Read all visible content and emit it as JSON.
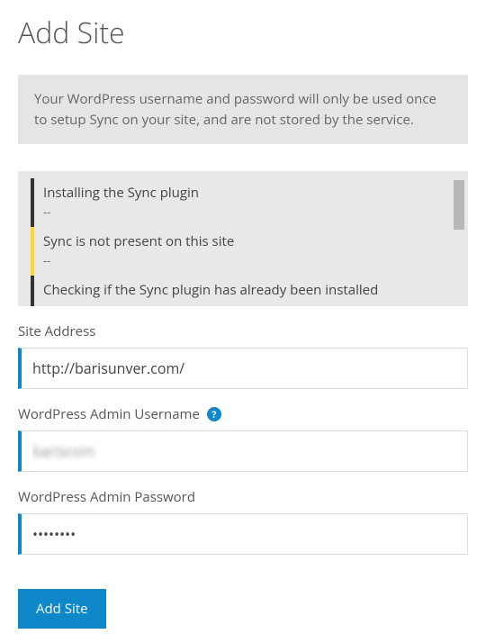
{
  "page": {
    "title": "Add Site"
  },
  "info": {
    "text": "Your WordPress username and password will only be used once to setup Sync on your site, and are not stored by the service."
  },
  "log": {
    "entries": [
      {
        "text": "Installing the Sync plugin",
        "status": "normal"
      },
      {
        "text": "Sync is not present on this site",
        "status": "warning"
      },
      {
        "text": "Checking if the Sync plugin has already been installed",
        "status": "normal"
      }
    ],
    "separator": "--"
  },
  "form": {
    "site_address": {
      "label": "Site Address",
      "value": "http://barisunver.com/"
    },
    "admin_username": {
      "label": "WordPress Admin Username",
      "value": "bariscom",
      "help_symbol": "?"
    },
    "admin_password": {
      "label": "WordPress Admin Password",
      "value": "••••••••"
    },
    "submit_label": "Add Site"
  },
  "colors": {
    "accent": "#0e88c9",
    "warning": "#ffd633"
  }
}
